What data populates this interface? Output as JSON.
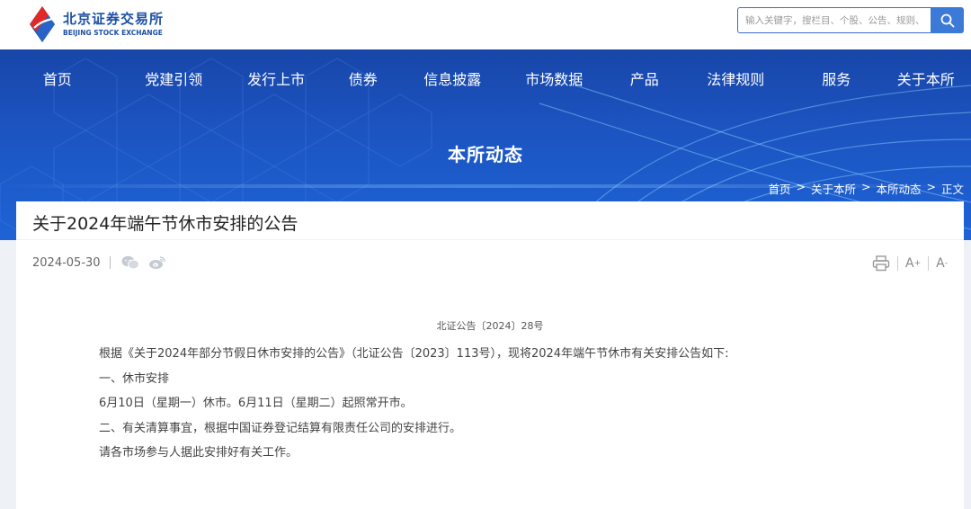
{
  "header": {
    "logo_cn": "北京证券交易所",
    "logo_en": "BEIJING STOCK EXCHANGE",
    "search_placeholder": "输入关键字，搜栏目、个股、公告、规则、",
    "colors": {
      "brand_blue": "#1d4fa5",
      "accent_red": "#e02a2a",
      "search_button": "#3c7ad8"
    },
    "icons": {
      "search": "search-icon",
      "logo": "bse-logo-icon"
    }
  },
  "nav": {
    "items": [
      {
        "label": "首页"
      },
      {
        "label": "党建引领"
      },
      {
        "label": "发行上市"
      },
      {
        "label": "债券"
      },
      {
        "label": "信息披露"
      },
      {
        "label": "市场数据"
      },
      {
        "label": "产品"
      },
      {
        "label": "法律规则"
      },
      {
        "label": "服务"
      },
      {
        "label": "关于本所"
      }
    ]
  },
  "banner": {
    "title": "本所动态",
    "breadcrumb": [
      "首页",
      "关于本所",
      "本所动态",
      "正文"
    ],
    "separator": ">"
  },
  "article": {
    "title": "关于2024年端午节休市安排的公告",
    "date": "2024-05-30",
    "share_icons": [
      "wechat-icon",
      "weibo-icon"
    ],
    "tools": {
      "print": "print-icon",
      "font_increase": "A",
      "font_decrease": "A"
    },
    "doc_number": "北证公告〔2024〕28号",
    "paragraphs": [
      "根据《关于2024年部分节假日休市安排的公告》（北证公告〔2023〕113号），现将2024年端午节休市有关安排公告如下:",
      "一、休市安排",
      "6月10日（星期一）休市。6月11日（星期二）起照常开市。",
      "二、有关清算事宜，根据中国证券登记结算有限责任公司的安排进行。",
      "请各市场参与人据此安排好有关工作。"
    ]
  }
}
